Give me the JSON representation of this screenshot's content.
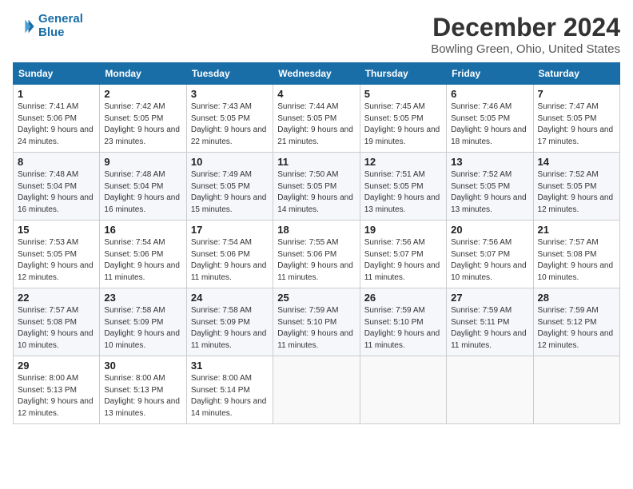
{
  "header": {
    "logo_line1": "General",
    "logo_line2": "Blue",
    "month": "December 2024",
    "location": "Bowling Green, Ohio, United States"
  },
  "weekdays": [
    "Sunday",
    "Monday",
    "Tuesday",
    "Wednesday",
    "Thursday",
    "Friday",
    "Saturday"
  ],
  "weeks": [
    [
      {
        "day": "1",
        "sunrise": "Sunrise: 7:41 AM",
        "sunset": "Sunset: 5:06 PM",
        "daylight": "Daylight: 9 hours and 24 minutes."
      },
      {
        "day": "2",
        "sunrise": "Sunrise: 7:42 AM",
        "sunset": "Sunset: 5:05 PM",
        "daylight": "Daylight: 9 hours and 23 minutes."
      },
      {
        "day": "3",
        "sunrise": "Sunrise: 7:43 AM",
        "sunset": "Sunset: 5:05 PM",
        "daylight": "Daylight: 9 hours and 22 minutes."
      },
      {
        "day": "4",
        "sunrise": "Sunrise: 7:44 AM",
        "sunset": "Sunset: 5:05 PM",
        "daylight": "Daylight: 9 hours and 21 minutes."
      },
      {
        "day": "5",
        "sunrise": "Sunrise: 7:45 AM",
        "sunset": "Sunset: 5:05 PM",
        "daylight": "Daylight: 9 hours and 19 minutes."
      },
      {
        "day": "6",
        "sunrise": "Sunrise: 7:46 AM",
        "sunset": "Sunset: 5:05 PM",
        "daylight": "Daylight: 9 hours and 18 minutes."
      },
      {
        "day": "7",
        "sunrise": "Sunrise: 7:47 AM",
        "sunset": "Sunset: 5:05 PM",
        "daylight": "Daylight: 9 hours and 17 minutes."
      }
    ],
    [
      {
        "day": "8",
        "sunrise": "Sunrise: 7:48 AM",
        "sunset": "Sunset: 5:04 PM",
        "daylight": "Daylight: 9 hours and 16 minutes."
      },
      {
        "day": "9",
        "sunrise": "Sunrise: 7:48 AM",
        "sunset": "Sunset: 5:04 PM",
        "daylight": "Daylight: 9 hours and 16 minutes."
      },
      {
        "day": "10",
        "sunrise": "Sunrise: 7:49 AM",
        "sunset": "Sunset: 5:05 PM",
        "daylight": "Daylight: 9 hours and 15 minutes."
      },
      {
        "day": "11",
        "sunrise": "Sunrise: 7:50 AM",
        "sunset": "Sunset: 5:05 PM",
        "daylight": "Daylight: 9 hours and 14 minutes."
      },
      {
        "day": "12",
        "sunrise": "Sunrise: 7:51 AM",
        "sunset": "Sunset: 5:05 PM",
        "daylight": "Daylight: 9 hours and 13 minutes."
      },
      {
        "day": "13",
        "sunrise": "Sunrise: 7:52 AM",
        "sunset": "Sunset: 5:05 PM",
        "daylight": "Daylight: 9 hours and 13 minutes."
      },
      {
        "day": "14",
        "sunrise": "Sunrise: 7:52 AM",
        "sunset": "Sunset: 5:05 PM",
        "daylight": "Daylight: 9 hours and 12 minutes."
      }
    ],
    [
      {
        "day": "15",
        "sunrise": "Sunrise: 7:53 AM",
        "sunset": "Sunset: 5:05 PM",
        "daylight": "Daylight: 9 hours and 12 minutes."
      },
      {
        "day": "16",
        "sunrise": "Sunrise: 7:54 AM",
        "sunset": "Sunset: 5:06 PM",
        "daylight": "Daylight: 9 hours and 11 minutes."
      },
      {
        "day": "17",
        "sunrise": "Sunrise: 7:54 AM",
        "sunset": "Sunset: 5:06 PM",
        "daylight": "Daylight: 9 hours and 11 minutes."
      },
      {
        "day": "18",
        "sunrise": "Sunrise: 7:55 AM",
        "sunset": "Sunset: 5:06 PM",
        "daylight": "Daylight: 9 hours and 11 minutes."
      },
      {
        "day": "19",
        "sunrise": "Sunrise: 7:56 AM",
        "sunset": "Sunset: 5:07 PM",
        "daylight": "Daylight: 9 hours and 11 minutes."
      },
      {
        "day": "20",
        "sunrise": "Sunrise: 7:56 AM",
        "sunset": "Sunset: 5:07 PM",
        "daylight": "Daylight: 9 hours and 10 minutes."
      },
      {
        "day": "21",
        "sunrise": "Sunrise: 7:57 AM",
        "sunset": "Sunset: 5:08 PM",
        "daylight": "Daylight: 9 hours and 10 minutes."
      }
    ],
    [
      {
        "day": "22",
        "sunrise": "Sunrise: 7:57 AM",
        "sunset": "Sunset: 5:08 PM",
        "daylight": "Daylight: 9 hours and 10 minutes."
      },
      {
        "day": "23",
        "sunrise": "Sunrise: 7:58 AM",
        "sunset": "Sunset: 5:09 PM",
        "daylight": "Daylight: 9 hours and 10 minutes."
      },
      {
        "day": "24",
        "sunrise": "Sunrise: 7:58 AM",
        "sunset": "Sunset: 5:09 PM",
        "daylight": "Daylight: 9 hours and 11 minutes."
      },
      {
        "day": "25",
        "sunrise": "Sunrise: 7:59 AM",
        "sunset": "Sunset: 5:10 PM",
        "daylight": "Daylight: 9 hours and 11 minutes."
      },
      {
        "day": "26",
        "sunrise": "Sunrise: 7:59 AM",
        "sunset": "Sunset: 5:10 PM",
        "daylight": "Daylight: 9 hours and 11 minutes."
      },
      {
        "day": "27",
        "sunrise": "Sunrise: 7:59 AM",
        "sunset": "Sunset: 5:11 PM",
        "daylight": "Daylight: 9 hours and 11 minutes."
      },
      {
        "day": "28",
        "sunrise": "Sunrise: 7:59 AM",
        "sunset": "Sunset: 5:12 PM",
        "daylight": "Daylight: 9 hours and 12 minutes."
      }
    ],
    [
      {
        "day": "29",
        "sunrise": "Sunrise: 8:00 AM",
        "sunset": "Sunset: 5:13 PM",
        "daylight": "Daylight: 9 hours and 12 minutes."
      },
      {
        "day": "30",
        "sunrise": "Sunrise: 8:00 AM",
        "sunset": "Sunset: 5:13 PM",
        "daylight": "Daylight: 9 hours and 13 minutes."
      },
      {
        "day": "31",
        "sunrise": "Sunrise: 8:00 AM",
        "sunset": "Sunset: 5:14 PM",
        "daylight": "Daylight: 9 hours and 14 minutes."
      },
      null,
      null,
      null,
      null
    ]
  ]
}
